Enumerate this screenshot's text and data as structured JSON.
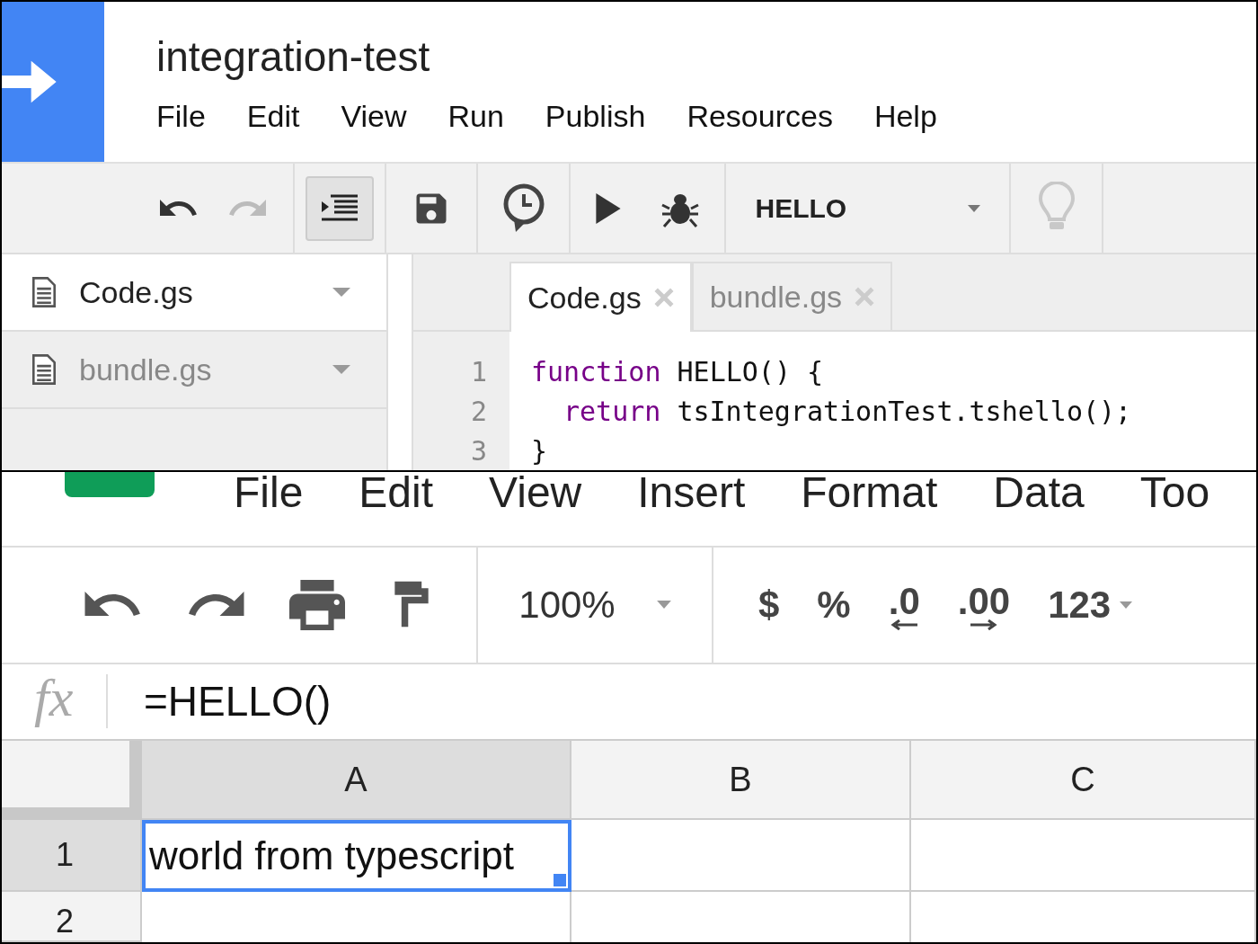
{
  "script_editor": {
    "title": "integration-test",
    "menu": [
      "File",
      "Edit",
      "View",
      "Run",
      "Publish",
      "Resources",
      "Help"
    ],
    "toolbar": {
      "undo_disabled": false,
      "redo_disabled": true,
      "indent_on": true,
      "function_select": "HELLO",
      "hint_disabled": true
    },
    "files": [
      {
        "name": "Code.gs",
        "selected": true
      },
      {
        "name": "bundle.gs",
        "selected": false
      }
    ],
    "tabs": [
      {
        "label": "Code.gs",
        "selected": true
      },
      {
        "label": "bundle.gs",
        "selected": false
      }
    ],
    "code_lines": [
      {
        "number": "1",
        "indented": false,
        "tokens": [
          {
            "kind": "keyword",
            "text": "function"
          },
          {
            "kind": "plain",
            "text": " HELLO() {"
          }
        ]
      },
      {
        "number": "2",
        "indented": true,
        "tokens": [
          {
            "kind": "keyword",
            "text": "return"
          },
          {
            "kind": "plain",
            "text": " tsIntegrationTest.tshello();"
          }
        ]
      },
      {
        "number": "3",
        "indented": false,
        "tokens": [
          {
            "kind": "plain",
            "text": "}"
          }
        ]
      }
    ]
  },
  "spreadsheet": {
    "menu": [
      "File",
      "Edit",
      "View",
      "Insert",
      "Format",
      "Data",
      "Too"
    ],
    "toolbar": {
      "zoom": "100%",
      "formats": [
        {
          "label": "$",
          "kind": "plain"
        },
        {
          "label": "%",
          "kind": "plain"
        },
        {
          "label": ".0",
          "kind": "decrease"
        },
        {
          "label": ".00",
          "kind": "increase"
        },
        {
          "label": "123",
          "kind": "dropdown"
        }
      ]
    },
    "formula_label": "fx",
    "formula": "=HELLO()",
    "columns": [
      {
        "label": "A",
        "selected": true
      },
      {
        "label": "B",
        "selected": false
      },
      {
        "label": "C",
        "selected": false
      }
    ],
    "rows": [
      {
        "number": "1",
        "selected": true,
        "cells": [
          "world from typescript"
        ]
      },
      {
        "number": "2",
        "selected": false,
        "cells": []
      }
    ]
  }
}
